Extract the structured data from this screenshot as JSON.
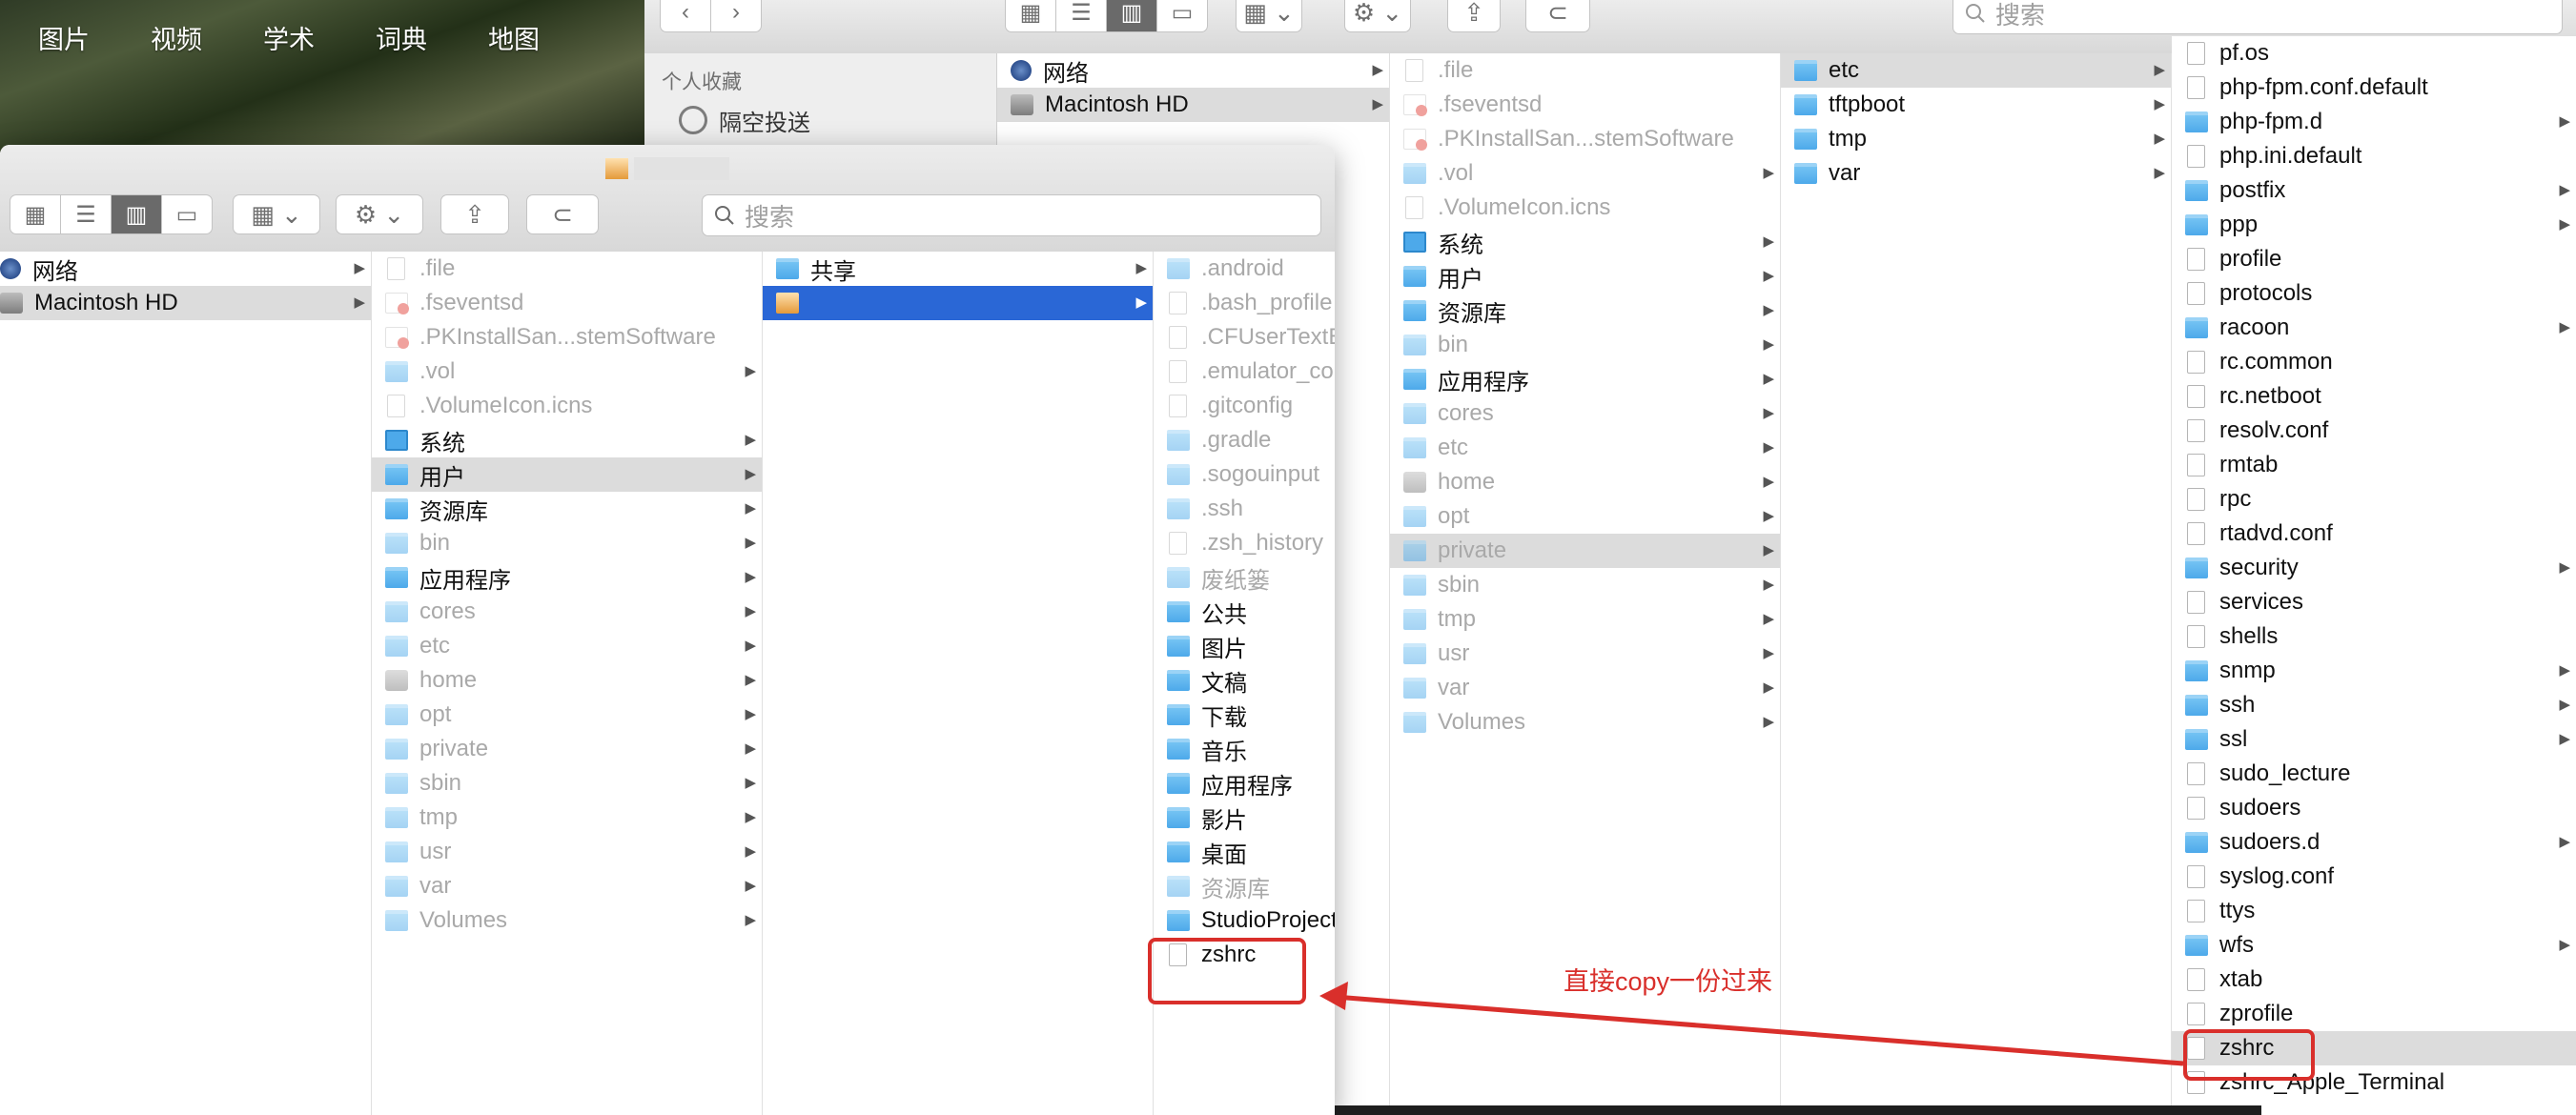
{
  "search_nav": [
    "图片",
    "视频",
    "学术",
    "词典",
    "地图"
  ],
  "back_window": {
    "search_placeholder": "搜索",
    "sidebar": {
      "header": "个人收藏",
      "items": [
        "隔空投送"
      ]
    },
    "col1": [
      {
        "label": "网络",
        "icon": "net",
        "arrow": true
      },
      {
        "label": "Macintosh HD",
        "icon": "disk",
        "arrow": true,
        "state": "hl"
      }
    ],
    "col2": [
      {
        "label": ".file",
        "icon": "file",
        "dim": true
      },
      {
        "label": ".fseventsd",
        "icon": "red",
        "dim": true
      },
      {
        "label": ".PKInstallSan...stemSoftware",
        "icon": "red",
        "dim": true
      },
      {
        "label": ".vol",
        "icon": "folder",
        "dim": true,
        "arrow": true
      },
      {
        "label": ".VolumeIcon.icns",
        "icon": "link",
        "dim": true
      },
      {
        "label": "系统",
        "icon": "sys",
        "arrow": true
      },
      {
        "label": "用户",
        "icon": "folder",
        "arrow": true
      },
      {
        "label": "资源库",
        "icon": "folder",
        "arrow": true
      },
      {
        "label": "bin",
        "icon": "folder",
        "dim": true,
        "arrow": true
      },
      {
        "label": "应用程序",
        "icon": "folder",
        "arrow": true
      },
      {
        "label": "cores",
        "icon": "folder",
        "dim": true,
        "arrow": true
      },
      {
        "label": "etc",
        "icon": "folder",
        "dim": true,
        "arrow": true
      },
      {
        "label": "home",
        "icon": "disk",
        "dim": true,
        "arrow": true
      },
      {
        "label": "opt",
        "icon": "folder",
        "dim": true,
        "arrow": true
      },
      {
        "label": "private",
        "icon": "folder",
        "dim": true,
        "arrow": true,
        "state": "hl"
      },
      {
        "label": "sbin",
        "icon": "folder",
        "dim": true,
        "arrow": true
      },
      {
        "label": "tmp",
        "icon": "folder",
        "dim": true,
        "arrow": true
      },
      {
        "label": "usr",
        "icon": "folder",
        "dim": true,
        "arrow": true
      },
      {
        "label": "var",
        "icon": "folder",
        "dim": true,
        "arrow": true
      },
      {
        "label": "Volumes",
        "icon": "folder",
        "dim": true,
        "arrow": true
      }
    ],
    "col3": [
      {
        "label": "etc",
        "icon": "folder",
        "arrow": true,
        "state": "hl"
      },
      {
        "label": "tftpboot",
        "icon": "folder",
        "arrow": true
      },
      {
        "label": "tmp",
        "icon": "folder",
        "arrow": true
      },
      {
        "label": "var",
        "icon": "folder",
        "arrow": true
      }
    ],
    "col4": [
      {
        "label": "pf.os",
        "icon": "file"
      },
      {
        "label": "php-fpm.conf.default",
        "icon": "file"
      },
      {
        "label": "php-fpm.d",
        "icon": "folder",
        "arrow": true
      },
      {
        "label": "php.ini.default",
        "icon": "file"
      },
      {
        "label": "postfix",
        "icon": "folder",
        "arrow": true
      },
      {
        "label": "ppp",
        "icon": "folder",
        "arrow": true
      },
      {
        "label": "profile",
        "icon": "file"
      },
      {
        "label": "protocols",
        "icon": "file"
      },
      {
        "label": "racoon",
        "icon": "folder",
        "arrow": true
      },
      {
        "label": "rc.common",
        "icon": "file"
      },
      {
        "label": "rc.netboot",
        "icon": "file"
      },
      {
        "label": "resolv.conf",
        "icon": "link"
      },
      {
        "label": "rmtab",
        "icon": "file"
      },
      {
        "label": "rpc",
        "icon": "file"
      },
      {
        "label": "rtadvd.conf",
        "icon": "file"
      },
      {
        "label": "security",
        "icon": "folder",
        "arrow": true
      },
      {
        "label": "services",
        "icon": "file"
      },
      {
        "label": "shells",
        "icon": "file"
      },
      {
        "label": "snmp",
        "icon": "folder",
        "arrow": true
      },
      {
        "label": "ssh",
        "icon": "folder",
        "arrow": true
      },
      {
        "label": "ssl",
        "icon": "folder",
        "arrow": true
      },
      {
        "label": "sudo_lecture",
        "icon": "file"
      },
      {
        "label": "sudoers",
        "icon": "file"
      },
      {
        "label": "sudoers.d",
        "icon": "folder",
        "arrow": true
      },
      {
        "label": "syslog.conf",
        "icon": "file"
      },
      {
        "label": "ttys",
        "icon": "file"
      },
      {
        "label": "wfs",
        "icon": "folder",
        "arrow": true
      },
      {
        "label": "xtab",
        "icon": "file"
      },
      {
        "label": "zprofile",
        "icon": "file"
      },
      {
        "label": "zshrc",
        "icon": "file",
        "state": "hl"
      },
      {
        "label": "zshrc_Apple_Terminal",
        "icon": "file"
      }
    ]
  },
  "front_window": {
    "title": "",
    "search_placeholder": "搜索",
    "col1": [
      {
        "label": "网络",
        "icon": "net",
        "arrow": true
      },
      {
        "label": "Macintosh HD",
        "icon": "disk",
        "arrow": true,
        "state": "hl"
      }
    ],
    "col2": [
      {
        "label": ".file",
        "icon": "file",
        "dim": true
      },
      {
        "label": ".fseventsd",
        "icon": "red",
        "dim": true
      },
      {
        "label": ".PKInstallSan...stemSoftware",
        "icon": "red",
        "dim": true
      },
      {
        "label": ".vol",
        "icon": "folder",
        "dim": true,
        "arrow": true
      },
      {
        "label": ".VolumeIcon.icns",
        "icon": "link",
        "dim": true
      },
      {
        "label": "系统",
        "icon": "sys",
        "arrow": true
      },
      {
        "label": "用户",
        "icon": "folder",
        "arrow": true,
        "state": "hl"
      },
      {
        "label": "资源库",
        "icon": "folder",
        "arrow": true
      },
      {
        "label": "bin",
        "icon": "folder",
        "dim": true,
        "arrow": true
      },
      {
        "label": "应用程序",
        "icon": "folder",
        "arrow": true
      },
      {
        "label": "cores",
        "icon": "folder",
        "dim": true,
        "arrow": true
      },
      {
        "label": "etc",
        "icon": "folder",
        "dim": true,
        "arrow": true
      },
      {
        "label": "home",
        "icon": "disk",
        "dim": true,
        "arrow": true
      },
      {
        "label": "opt",
        "icon": "folder",
        "dim": true,
        "arrow": true
      },
      {
        "label": "private",
        "icon": "folder",
        "dim": true,
        "arrow": true
      },
      {
        "label": "sbin",
        "icon": "folder",
        "dim": true,
        "arrow": true
      },
      {
        "label": "tmp",
        "icon": "folder",
        "dim": true,
        "arrow": true
      },
      {
        "label": "usr",
        "icon": "folder",
        "dim": true,
        "arrow": true
      },
      {
        "label": "var",
        "icon": "folder",
        "dim": true,
        "arrow": true
      },
      {
        "label": "Volumes",
        "icon": "folder",
        "dim": true,
        "arrow": true
      }
    ],
    "col3": [
      {
        "label": "共享",
        "icon": "folder",
        "arrow": true
      },
      {
        "label": "",
        "icon": "home",
        "arrow": true,
        "state": "sel"
      }
    ],
    "col4": [
      {
        "label": ".android",
        "icon": "folder",
        "dim": true
      },
      {
        "label": ".bash_profile",
        "icon": "file",
        "dim": true
      },
      {
        "label": ".CFUserTextEncoding",
        "icon": "file",
        "dim": true
      },
      {
        "label": ".emulator_console_auth_token",
        "icon": "file",
        "dim": true
      },
      {
        "label": ".gitconfig",
        "icon": "file",
        "dim": true
      },
      {
        "label": ".gradle",
        "icon": "folder",
        "dim": true
      },
      {
        "label": ".sogouinput",
        "icon": "folder",
        "dim": true
      },
      {
        "label": ".ssh",
        "icon": "folder",
        "dim": true
      },
      {
        "label": ".zsh_history",
        "icon": "file",
        "dim": true
      },
      {
        "label": "废纸篓",
        "icon": "folder",
        "dim": true
      },
      {
        "label": "公共",
        "icon": "folder"
      },
      {
        "label": "图片",
        "icon": "folder"
      },
      {
        "label": "文稿",
        "icon": "folder"
      },
      {
        "label": "下载",
        "icon": "folder"
      },
      {
        "label": "音乐",
        "icon": "folder"
      },
      {
        "label": "应用程序",
        "icon": "folder"
      },
      {
        "label": "影片",
        "icon": "folder"
      },
      {
        "label": "桌面",
        "icon": "folder"
      },
      {
        "label": "资源库",
        "icon": "folder",
        "dim": true
      },
      {
        "label": "StudioProjects",
        "icon": "folder"
      },
      {
        "label": "zshrc",
        "icon": "file"
      }
    ]
  },
  "annotation": "直接copy一份过来",
  "colors": {
    "accent": "#2a67d6",
    "annotation": "#d92f2b",
    "folder": "#4da9ea"
  }
}
